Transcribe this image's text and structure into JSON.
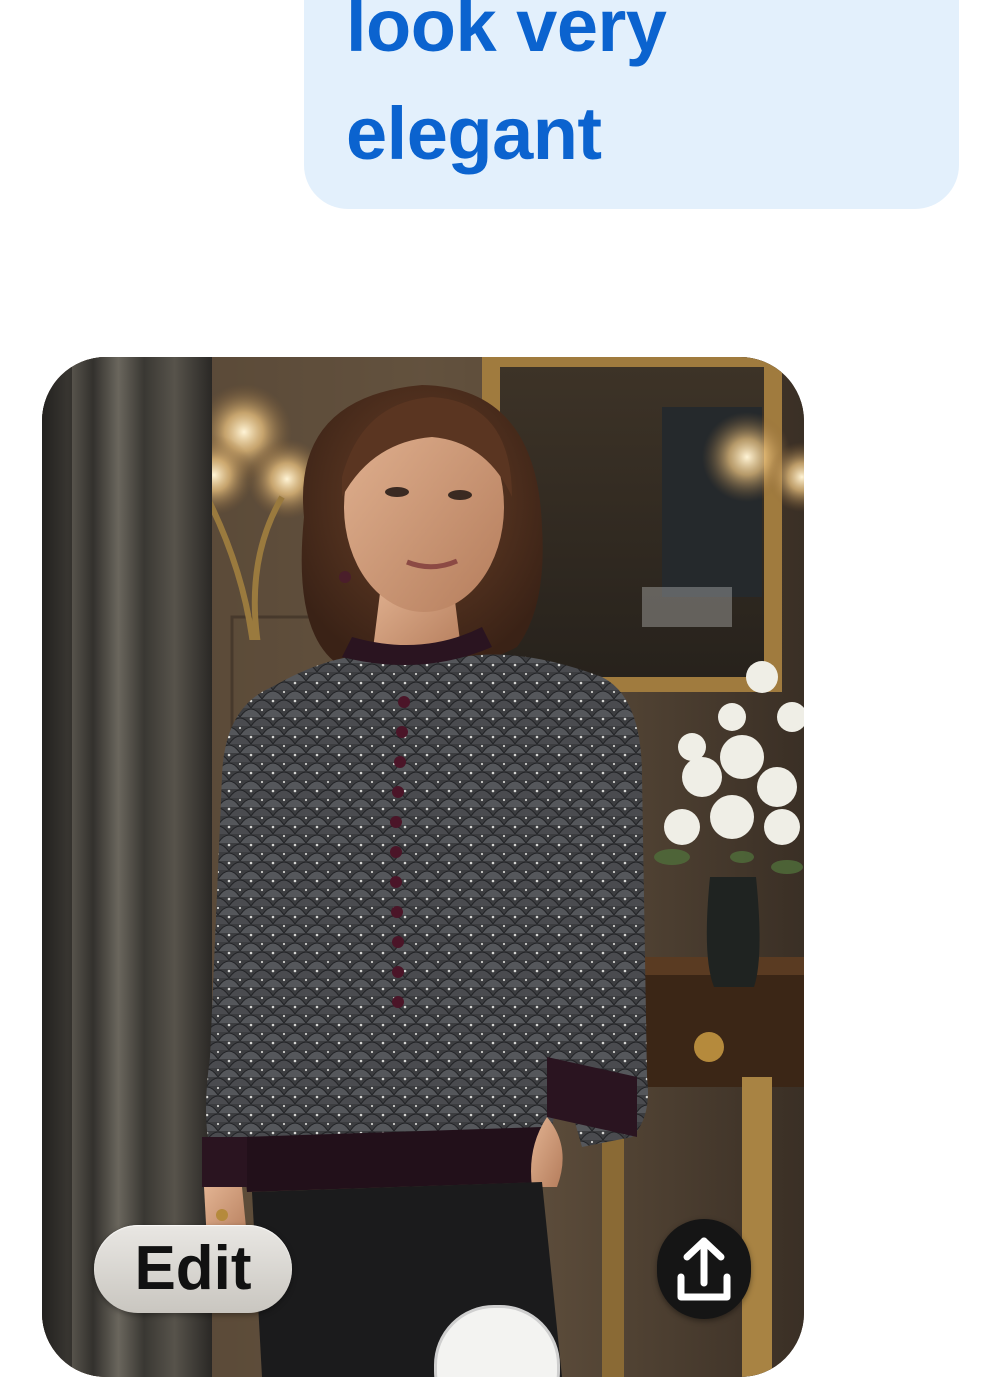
{
  "message": {
    "lines": [
      "look very",
      "elegant"
    ]
  },
  "image_card": {
    "description_icon": "generated-photo",
    "edit_label": "Edit",
    "share_icon": "share-icon"
  },
  "colors": {
    "bubble_bg": "#e3f0fc",
    "bubble_text": "#0b63cf",
    "share_bg": "#151515",
    "edit_bg": "#d8d6d2"
  }
}
